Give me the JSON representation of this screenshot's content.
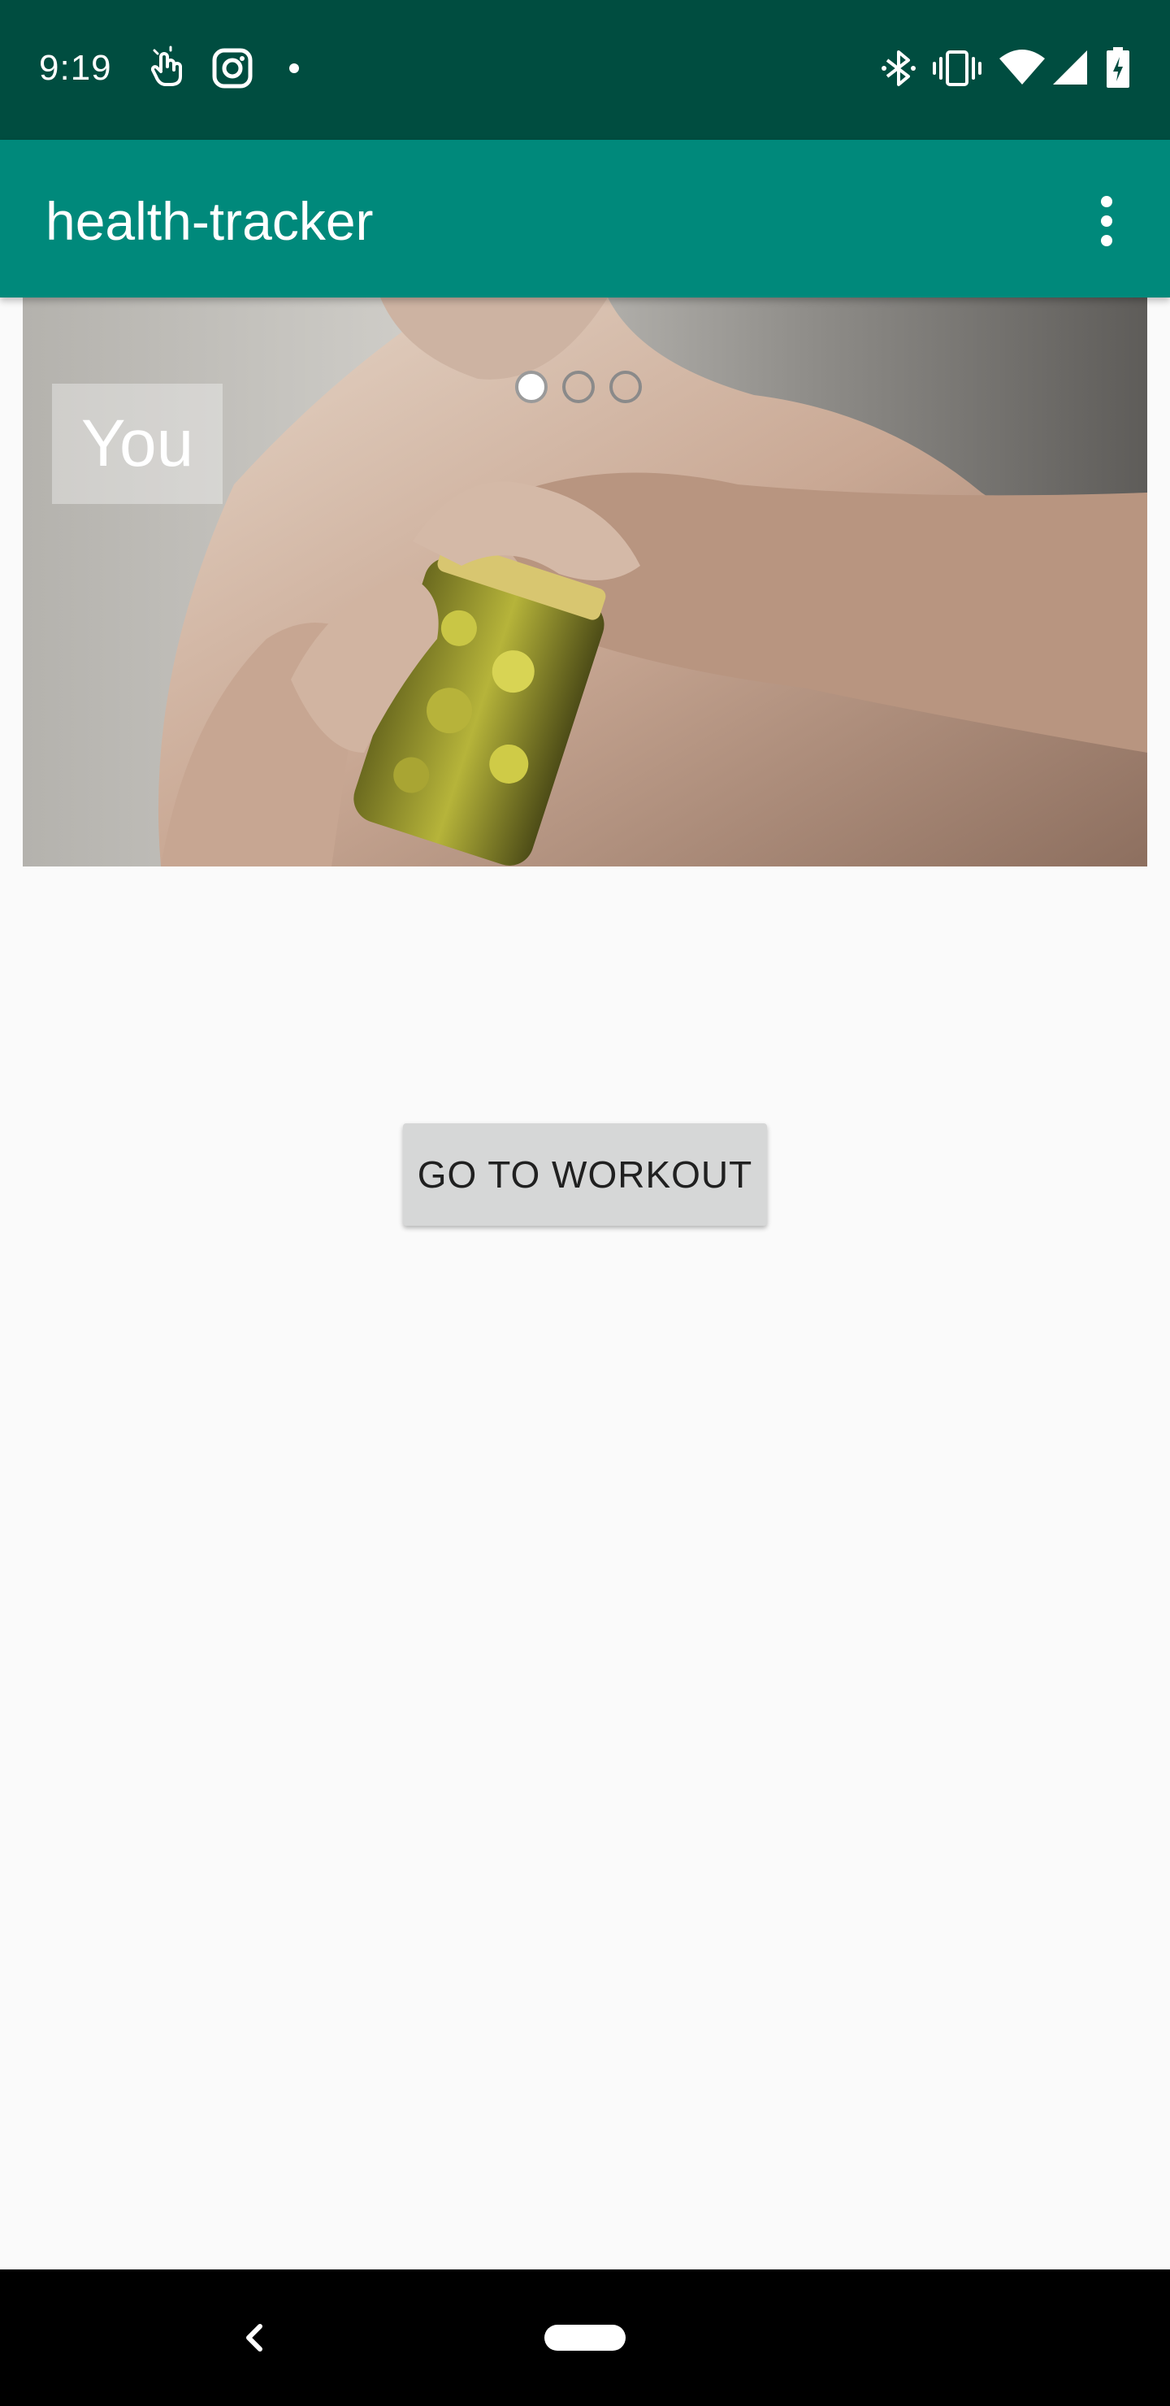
{
  "status_bar": {
    "time": "9:19",
    "left_icons": [
      "touch-gesture-icon",
      "instagram-icon",
      "notification-dot-icon"
    ],
    "right_icons": [
      "bluetooth-icon",
      "vibrate-icon",
      "wifi-icon",
      "cell-signal-icon",
      "battery-charging-icon"
    ]
  },
  "app_bar": {
    "title": "health-tracker",
    "menu_icon": "more-vert-icon"
  },
  "carousel": {
    "caption": "You",
    "indicator_count": 3,
    "active_index": 0
  },
  "main": {
    "button_label": "GO TO WORKOUT"
  },
  "nav_bar": {
    "back_icon": "back-chevron-icon",
    "home_icon": "home-pill-icon"
  },
  "colors": {
    "status_bar": "#004d40",
    "app_bar": "#00897b",
    "background": "#fafafa",
    "button": "#d6d7d7"
  }
}
